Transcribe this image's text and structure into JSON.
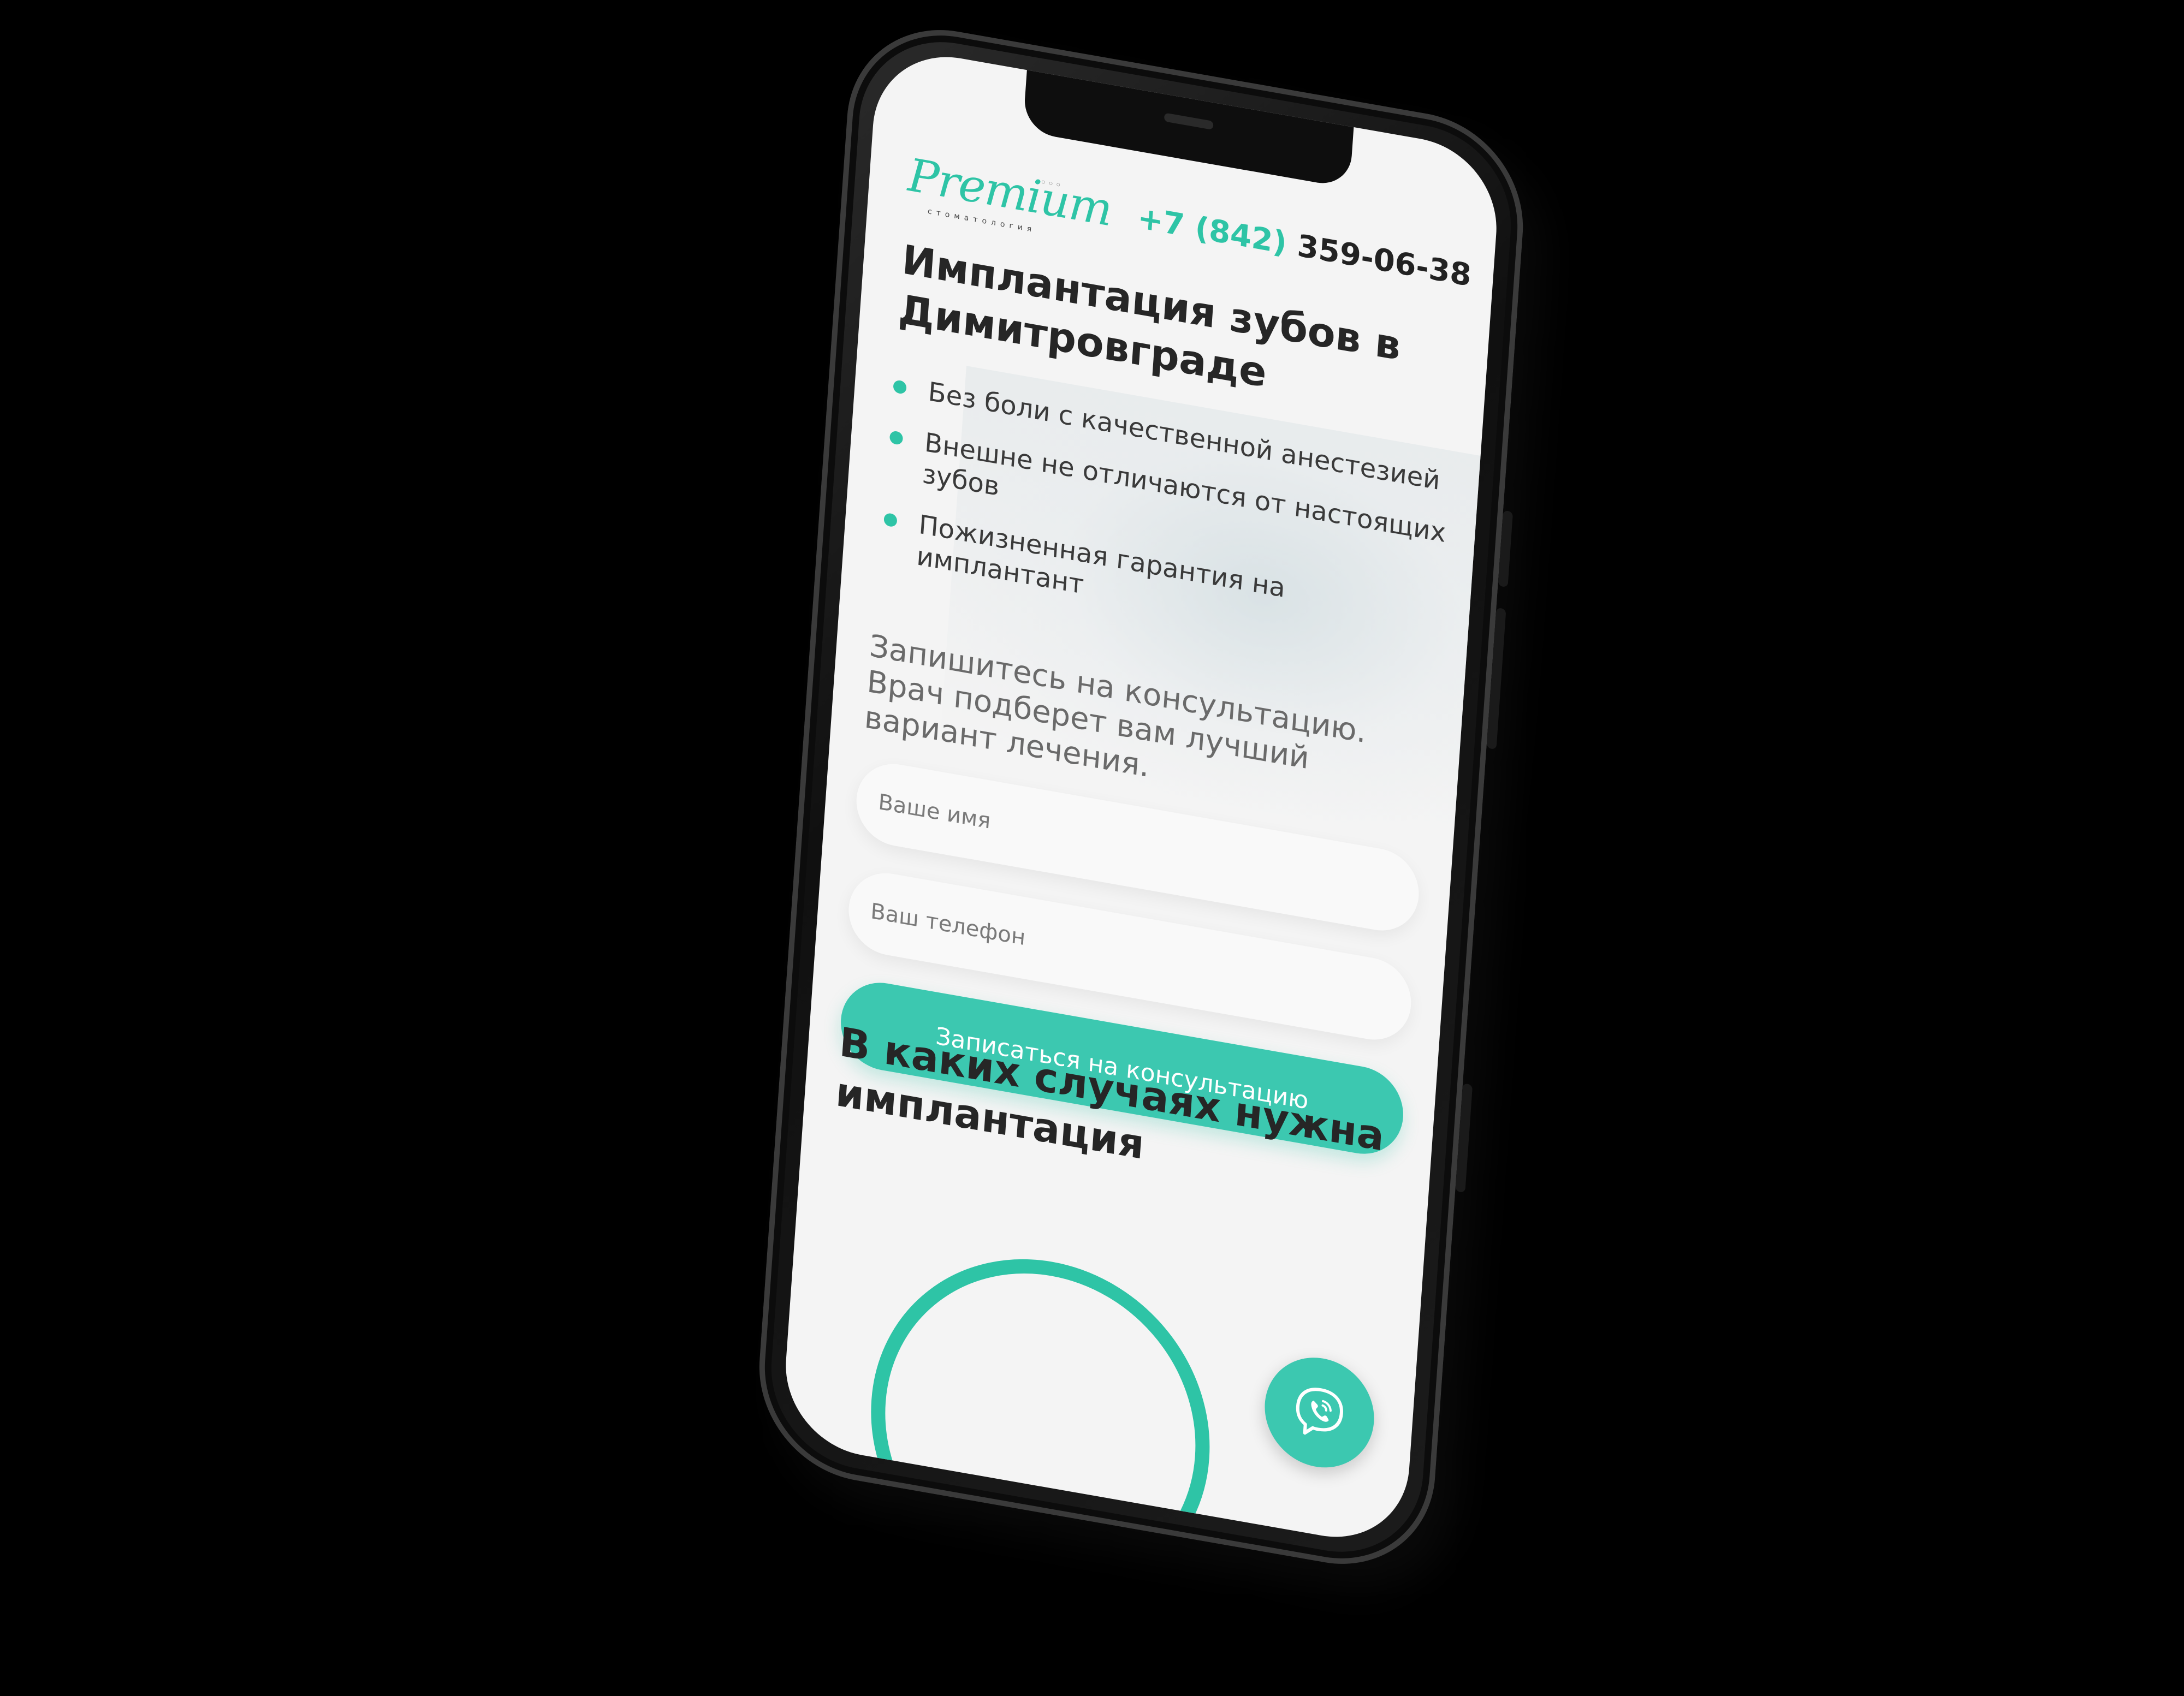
{
  "header": {
    "logo_text": "Premium",
    "logo_subtitle": "стоматология",
    "phone_code": "+7 (842)",
    "phone_rest": " 359-06-38"
  },
  "hero": {
    "title": "Имплантация зубов в Димитровграде",
    "features": [
      "Без боли с качественной анестезией",
      "Внешне не отличаются от настоящих зубов",
      "Пожизненная гарантия на имплантант"
    ],
    "lead": "Запишитесь на консультацию. Врач подберет вам лучший вариант лечения."
  },
  "form": {
    "name_placeholder": "Ваше имя",
    "phone_placeholder": "Ваш телефон",
    "submit_label": "Записаться на консультацию"
  },
  "section": {
    "title": "В каких случаях нужна имплантация"
  },
  "colors": {
    "accent": "#2ec4a6",
    "button": "#3cc8b0",
    "text": "#262626",
    "background": "#f4f4f4"
  },
  "icons": {
    "fab": "viber-phone-icon",
    "bullet": "dot-icon"
  }
}
